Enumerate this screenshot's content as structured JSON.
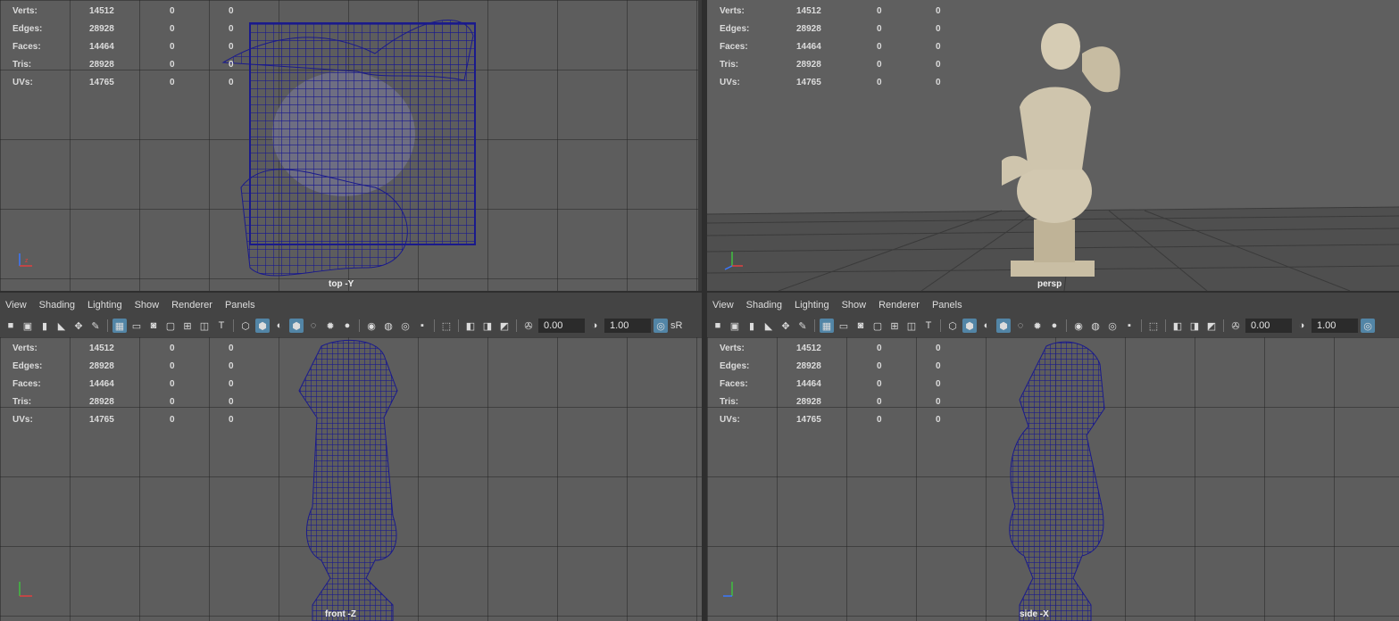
{
  "stats": [
    {
      "label": "Verts:",
      "v": "14512",
      "a": "0",
      "b": "0"
    },
    {
      "label": "Edges:",
      "v": "28928",
      "a": "0",
      "b": "0"
    },
    {
      "label": "Faces:",
      "v": "14464",
      "a": "0",
      "b": "0"
    },
    {
      "label": "Tris:",
      "v": "28928",
      "a": "0",
      "b": "0"
    },
    {
      "label": "UVs:",
      "v": "14765",
      "a": "0",
      "b": "0"
    }
  ],
  "viewports": {
    "top_left": {
      "camera": "top -Y"
    },
    "top_right": {
      "camera": "persp"
    },
    "bottom_left": {
      "camera": "front -Z"
    },
    "bottom_right": {
      "camera": "side -X"
    }
  },
  "panel_menu": [
    "View",
    "Shading",
    "Lighting",
    "Show",
    "Renderer",
    "Panels"
  ],
  "toolbar": {
    "exposure": "0.00",
    "gamma": "1.00",
    "color_space_left": "sR",
    "icons": [
      "camera-select-icon",
      "camera-attributes-icon",
      "bookmark-icon",
      "image-plane-icon",
      "2d-pan-zoom-icon",
      "grease-pencil-icon",
      "grid-icon",
      "film-gate-icon",
      "resolution-gate-icon",
      "gate-mask-icon",
      "field-chart-icon",
      "safe-action-icon",
      "safe-title-icon",
      "wireframe-icon",
      "smooth-shade-icon",
      "default-material-icon",
      "wireframe-on-shaded-icon",
      "xray-icon",
      "use-lights-icon",
      "shadows-icon",
      "ambient-occlusion-icon",
      "motion-blur-icon",
      "anti-aliasing-icon",
      "depth-of-field-icon",
      "isolate-select-icon",
      "xray-joints-icon",
      "xray-active-icon",
      "backface-icon",
      "exposure-icon",
      "gamma-icon",
      "color-management-icon"
    ]
  },
  "colors": {
    "viewport_bg": "#5d5d5d",
    "wire": "#1a1a8c",
    "active_icon": "#5285a6",
    "statue": "#cfc5ad"
  }
}
